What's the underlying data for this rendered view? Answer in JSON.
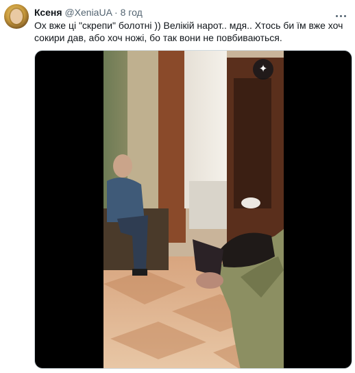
{
  "tweet": {
    "author_name": "Ксеня",
    "author_handle": "@XeniaUA",
    "separator": "·",
    "time": "8 год",
    "text": "Ох вже ці \"скрепи\" болотні )) Велікій нарот.. мдя.. Хтось би їм вже хоч сокири дав, або хоч ножі, бо так вони не повбиваються."
  },
  "icons": {
    "more": "more-horizontal-icon",
    "media_action": "sparkle-icon"
  },
  "media_action_glyph": "✦"
}
